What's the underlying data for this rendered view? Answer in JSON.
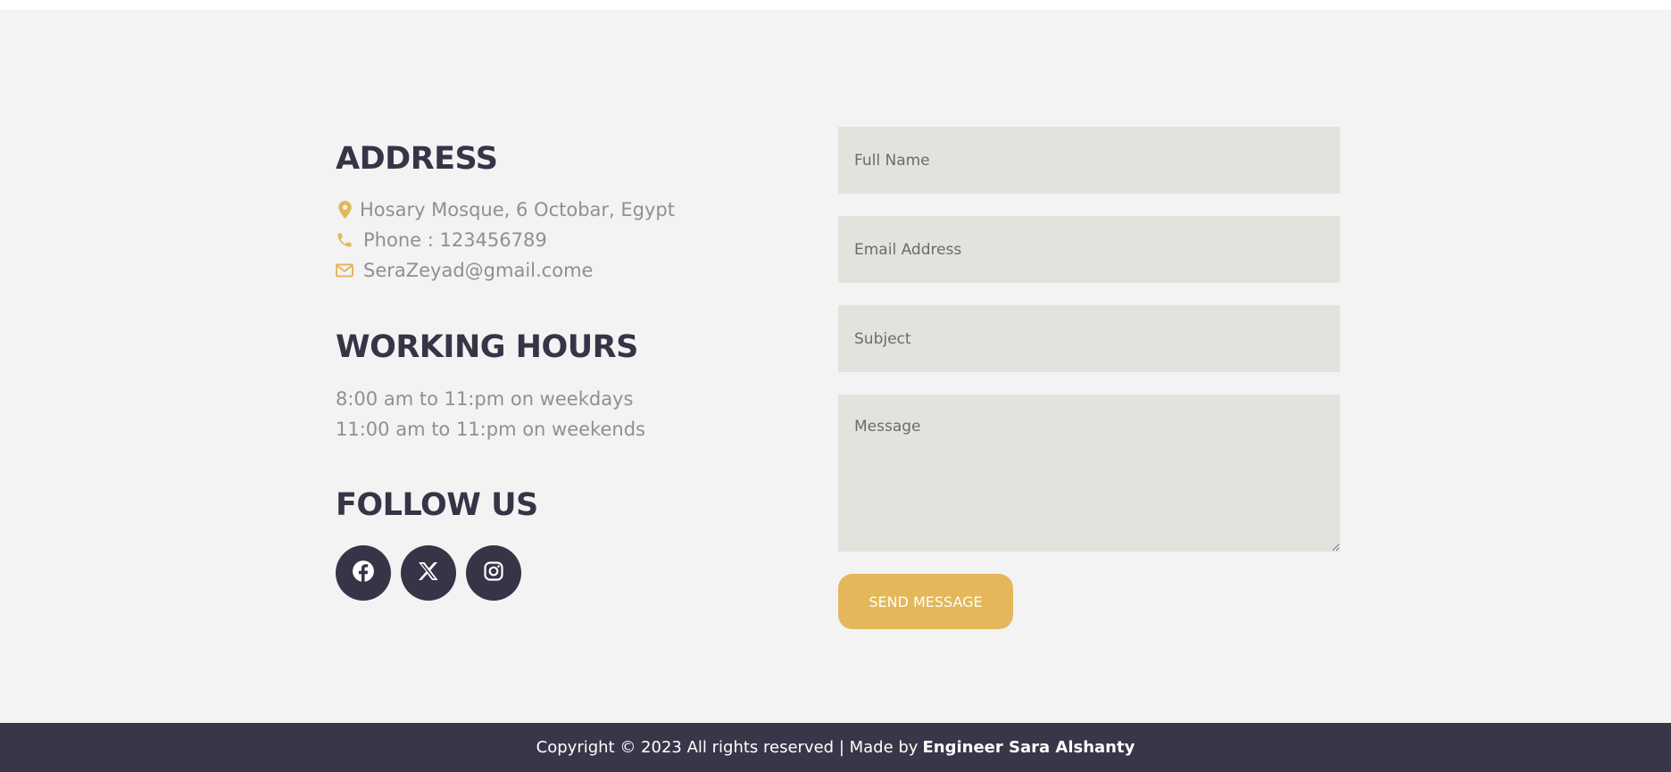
{
  "address": {
    "heading": "ADDRESS",
    "location": "Hosary Mosque, 6 Octobar, Egypt",
    "phone": "Phone : 123456789",
    "email": "SeraZeyad@gmail.come",
    "icons": {
      "location": "map-pin-icon",
      "phone": "phone-icon",
      "email": "envelope-icon"
    }
  },
  "hours": {
    "heading": "WORKING HOURS",
    "weekdays": "8:00 am to 11:pm on weekdays",
    "weekends": "11:00 am to 11:pm on weekends"
  },
  "follow": {
    "heading": "FOLLOW US",
    "networks": [
      "facebook-icon",
      "x-twitter-icon",
      "instagram-icon"
    ]
  },
  "form": {
    "name_placeholder": "Full Name",
    "email_placeholder": "Email Address",
    "subject_placeholder": "Subject",
    "message_placeholder": "Message",
    "send_label": "SEND MESSAGE"
  },
  "footer": {
    "text": "Copyright © 2023 All rights reserved | Made by",
    "author": "Engineer Sara Alshanty"
  },
  "colors": {
    "accent": "#e3b75a",
    "dark": "#373447",
    "section_bg": "#f3f3f3",
    "field_bg": "#e3e2dd",
    "footer_bg": "#383749",
    "muted_text": "#8f8f95"
  }
}
